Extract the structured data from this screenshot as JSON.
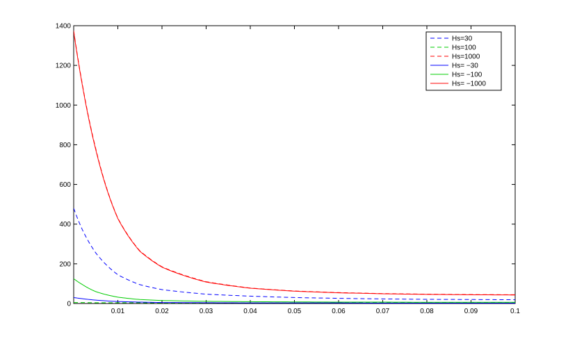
{
  "chart_data": {
    "type": "line",
    "title": "",
    "xlabel": "",
    "ylabel": "",
    "xlim": [
      0.0,
      0.1
    ],
    "ylim": [
      0,
      1400
    ],
    "grid": false,
    "legend_position": "top-right",
    "x_ticks": [
      {
        "value": 0.01,
        "label": "0.01"
      },
      {
        "value": 0.02,
        "label": "0.02"
      },
      {
        "value": 0.03,
        "label": "0.03"
      },
      {
        "value": 0.04,
        "label": "0.04"
      },
      {
        "value": 0.05,
        "label": "0.05"
      },
      {
        "value": 0.06,
        "label": "0.06"
      },
      {
        "value": 0.07,
        "label": "0.07"
      },
      {
        "value": 0.08,
        "label": "0.08"
      },
      {
        "value": 0.09,
        "label": "0.09"
      },
      {
        "value": 0.1,
        "label": "0.1"
      }
    ],
    "y_ticks": [
      {
        "value": 0,
        "label": "0"
      },
      {
        "value": 200,
        "label": "200"
      },
      {
        "value": 400,
        "label": "400"
      },
      {
        "value": 600,
        "label": "600"
      },
      {
        "value": 800,
        "label": "800"
      },
      {
        "value": 1000,
        "label": "1000"
      },
      {
        "value": 1200,
        "label": "1200"
      },
      {
        "value": 1400,
        "label": "1400"
      }
    ],
    "x": [
      0.0,
      0.002,
      0.005,
      0.01,
      0.015,
      0.02,
      0.03,
      0.04,
      0.05,
      0.06,
      0.07,
      0.08,
      0.09,
      0.1
    ],
    "series": [
      {
        "name": "Hs=30",
        "color": "#0000ff",
        "dash": "dashed",
        "values": [
          480,
          370,
          255,
          145,
          95,
          70,
          47,
          37,
          30,
          26,
          23,
          21,
          20,
          19
        ]
      },
      {
        "name": "Hs=100",
        "color": "#00cc00",
        "dash": "dashed",
        "values": [
          5,
          5,
          4,
          4,
          4,
          3,
          3,
          3,
          3,
          3,
          3,
          3,
          3,
          3
        ]
      },
      {
        "name": "Hs=1000",
        "color": "#ff0000",
        "dash": "dashed",
        "values": [
          1375,
          1100,
          780,
          430,
          265,
          185,
          110,
          78,
          63,
          55,
          50,
          47,
          45,
          44
        ]
      },
      {
        "name": "Hs= −30",
        "color": "#0000ff",
        "dash": "solid",
        "values": [
          30,
          24,
          17,
          10,
          7,
          5,
          4,
          3,
          3,
          3,
          2,
          2,
          2,
          2
        ]
      },
      {
        "name": "Hs= −100",
        "color": "#00cc00",
        "dash": "solid",
        "values": [
          125,
          95,
          60,
          32,
          20,
          15,
          11,
          9,
          8,
          7,
          7,
          6,
          6,
          6
        ]
      },
      {
        "name": "Hs= −1000",
        "color": "#ff0000",
        "dash": "solid",
        "values": [
          1370,
          1095,
          775,
          428,
          263,
          183,
          108,
          77,
          62,
          54,
          49,
          46,
          44,
          43
        ]
      }
    ]
  }
}
